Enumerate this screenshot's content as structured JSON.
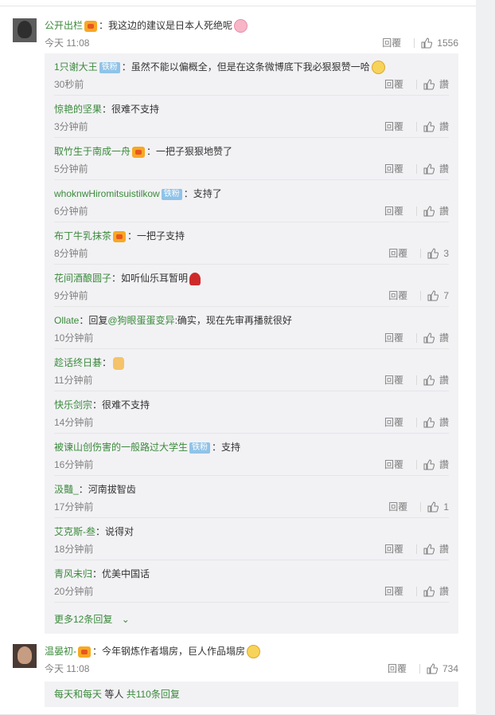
{
  "comment1": {
    "name": "公开出栏",
    "text": "：我这边的建议是日本人死绝呢",
    "time": "今天 11:08",
    "reply_label": "回覆",
    "like_count": "1556"
  },
  "replies": [
    {
      "name": "1只谢大王",
      "badge": "铁粉",
      "text": "：虽然不能以偏概全，但是在这条微博底下我必狠狠赞一哈",
      "emoji": "smile",
      "time": "30秒前",
      "reply": "回覆",
      "like": "讚"
    },
    {
      "name": "惊艳的坚果",
      "text": "：很难不支持",
      "time": "3分钟前",
      "reply": "回覆",
      "like": "讚"
    },
    {
      "name": "取竹生于南成一舟",
      "vip": true,
      "text": "：一把子狠狠地赞了",
      "time": "5分钟前",
      "reply": "回覆",
      "like": "讚"
    },
    {
      "name": "whoknwHiromitsuistilkow",
      "badge": "铁粉",
      "text": "：支持了",
      "time": "6分钟前",
      "reply": "回覆",
      "like": "讚"
    },
    {
      "name": "布丁牛乳抹茶",
      "vip": true,
      "text": "：一把子支持",
      "time": "8分钟前",
      "reply": "回覆",
      "like": "3"
    },
    {
      "name": "花间酒酿圆子",
      "text": "：如听仙乐耳暂明",
      "emoji": "rose",
      "time": "9分钟前",
      "reply": "回覆",
      "like": "7"
    },
    {
      "name": "Ollate",
      "text": "：回复",
      "mention": "@狗眼蛋蛋变异",
      "text2": ":确实，现在先审再播就很好",
      "time": "10分钟前",
      "reply": "回覆",
      "like": "讚"
    },
    {
      "name": "趁话终日碁",
      "text": "：",
      "emoji": "thumb",
      "time": "11分钟前",
      "reply": "回覆",
      "like": "讚"
    },
    {
      "name": "快乐剑宗",
      "text": "：很难不支持",
      "time": "14分钟前",
      "reply": "回覆",
      "like": "讚"
    },
    {
      "name": "被谏山创伤害的一般路过大学生",
      "badge": "铁粉",
      "text": "：支持",
      "time": "16分钟前",
      "reply": "回覆",
      "like": "讚"
    },
    {
      "name": "汲豔_",
      "text": "：河南拔智齿",
      "time": "17分钟前",
      "reply": "回覆",
      "like": "1"
    },
    {
      "name": "艾克斯-叁",
      "text": "：说得对",
      "time": "18分钟前",
      "reply": "回覆",
      "like": "讚"
    },
    {
      "name": "青风未归",
      "text": "：优美中国话",
      "time": "20分钟前",
      "reply": "回覆",
      "like": "讚"
    }
  ],
  "more_replies": "更多12条回复",
  "comment2": {
    "name": "温晏初-",
    "text": "：今年钢炼作者塌房，巨人作品塌房",
    "time": "今天 11:08",
    "reply_label": "回覆",
    "like_count": "734"
  },
  "summary": {
    "names": "每天和每天",
    "suffix": "等人",
    "count": "共110条回复"
  }
}
